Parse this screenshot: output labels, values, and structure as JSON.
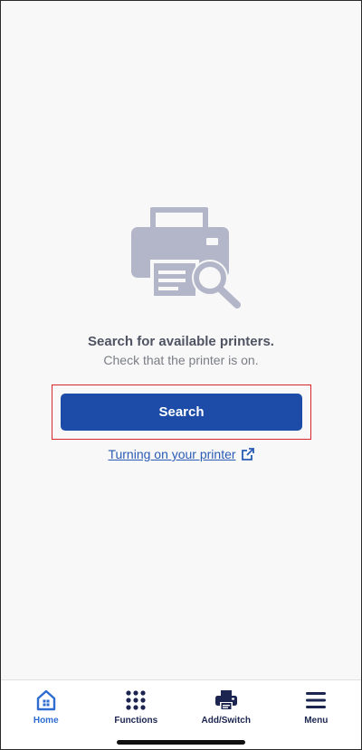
{
  "main": {
    "title": "Search for available printers.",
    "subtitle": "Check that the printer is on.",
    "search_button_label": "Search",
    "help_link_label": "Turning on your printer"
  },
  "tabbar": {
    "items": [
      {
        "label": "Home",
        "icon": "home-icon",
        "active": true
      },
      {
        "label": "Functions",
        "icon": "grid-icon",
        "active": false
      },
      {
        "label": "Add/Switch",
        "icon": "printer-icon",
        "active": false
      },
      {
        "label": "Menu",
        "icon": "hamburger-menu-icon",
        "active": false
      }
    ]
  },
  "colors": {
    "accent": "#1c4ca7",
    "active_tab": "#2e6cd1",
    "tab_icon": "#1b2550",
    "highlight_border": "#d8262f",
    "illustration": "#b3b6c8"
  }
}
